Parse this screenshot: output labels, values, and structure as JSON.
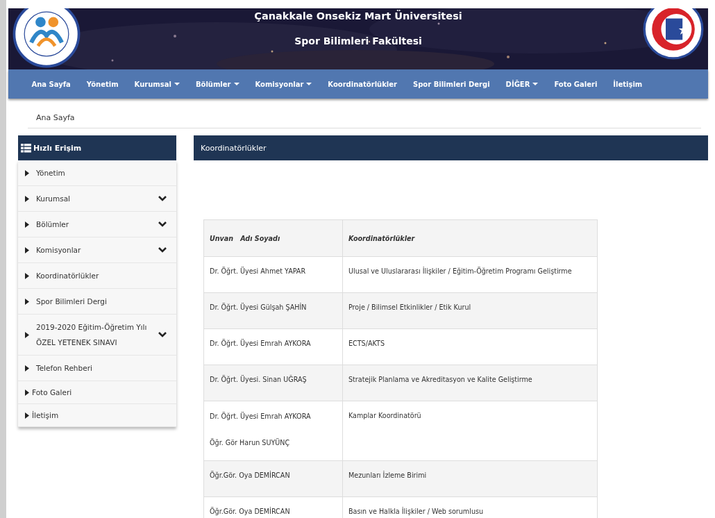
{
  "header": {
    "title": "Çanakkale Onsekiz Mart Üniversitesi",
    "subtitle": "Spor Bilimleri Fakültesi"
  },
  "nav": [
    {
      "label": "Ana Sayfa",
      "dropdown": false
    },
    {
      "label": "Yönetim",
      "dropdown": false
    },
    {
      "label": "Kurumsal",
      "dropdown": true
    },
    {
      "label": "Bölümler",
      "dropdown": true
    },
    {
      "label": "Komisyonlar",
      "dropdown": true
    },
    {
      "label": "Koordinatörlükler",
      "dropdown": false
    },
    {
      "label": "Spor Bilimleri Dergi",
      "dropdown": false
    },
    {
      "label": "DİĞER",
      "dropdown": true
    },
    {
      "label": "Foto Galeri",
      "dropdown": false
    },
    {
      "label": "İletişim",
      "dropdown": false
    }
  ],
  "breadcrumb": [
    "Ana Sayfa"
  ],
  "sidebar": {
    "title": "Hızlı Erişim",
    "items": [
      {
        "label": "Yönetim",
        "kind": "spaced",
        "expandable": false
      },
      {
        "label": "Kurumsal",
        "kind": "spaced",
        "expandable": true
      },
      {
        "label": "Bölümler",
        "kind": "spaced",
        "expandable": true
      },
      {
        "label": "Komisyonlar",
        "kind": "spaced",
        "expandable": true
      },
      {
        "label": "Koordinatörlükler",
        "kind": "spaced",
        "expandable": false
      },
      {
        "label": "Spor Bilimleri Dergi",
        "kind": "spaced",
        "expandable": false
      },
      {
        "label": "2019-2020 Eğitim-Öğretim Yılı ÖZEL YETENEK SINAVI",
        "kind": "spaced",
        "expandable": true
      },
      {
        "label": "Telefon Rehberi",
        "kind": "spaced",
        "expandable": false
      },
      {
        "label": "Foto Galeri",
        "kind": "compact",
        "expandable": false
      },
      {
        "label": "İletişim",
        "kind": "compact",
        "expandable": false
      }
    ]
  },
  "panel": {
    "title": "Koordinatörlükler"
  },
  "table": {
    "columns": [
      "Unvan   Adı Soyadı",
      "Koordinatörlükler"
    ],
    "rows": [
      {
        "names": [
          "Dr. Öğrt. Üyesi Ahmet YAPAR"
        ],
        "role": "Ulusal ve Uluslararası İlişkiler / Eğitim-Öğretim Programı Geliştirme"
      },
      {
        "names": [
          "Dr. Öğrt. Üyesi Gülşah ŞAHİN"
        ],
        "role": "Proje / Bilimsel Etkinlikler / Etik Kurul"
      },
      {
        "names": [
          "Dr. Öğrt. Üyesi Emrah AYKORA"
        ],
        "role": "ECTS/AKTS"
      },
      {
        "names": [
          "Dr. Öğrt. Üyesi. Sinan UĞRAŞ"
        ],
        "role": "Stratejik Planlama ve Akreditasyon ve Kalite Geliştirme"
      },
      {
        "names": [
          "Dr. Öğrt. Üyesi Emrah AYKORA",
          "Öğr. Gör Harun SUYÜNÇ"
        ],
        "role": "Kamplar Koordinatörü"
      },
      {
        "names": [
          "Öğr.Gör. Oya DEMİRCAN"
        ],
        "role": "Mezunları İzleme Birimi"
      },
      {
        "names": [
          "Öğr.Gör. Oya DEMİRCAN"
        ],
        "role": "Basın ve Halkla İlişkiler / Web sorumlusu"
      }
    ]
  }
}
